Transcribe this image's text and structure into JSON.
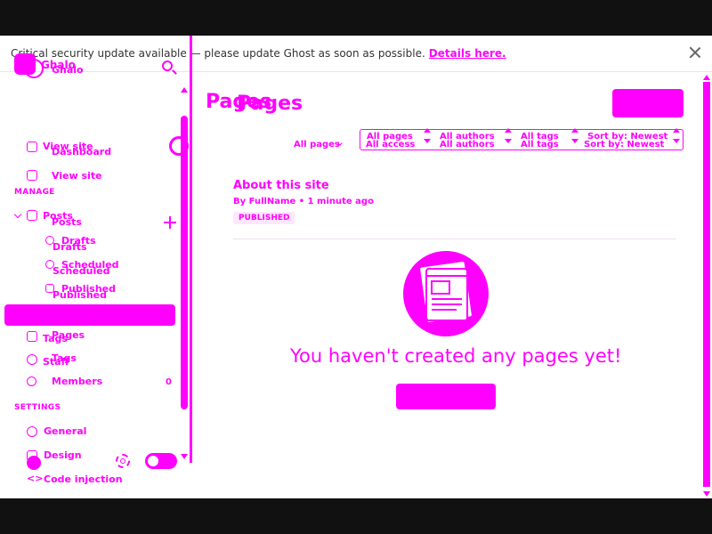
{
  "banner": {
    "text": "Critical security update available — please update Ghost as soon as possible.",
    "link": "Details here."
  },
  "sidebar": {
    "site_title": "Ghalo",
    "site_title_overlay": "Ghalo",
    "nav_top": [
      {
        "label": "View site",
        "overlay": "Dashboard"
      },
      {
        "label": "View site"
      }
    ],
    "manage_label": "MANAGE",
    "posts": {
      "label": "Posts",
      "overlay": "Posts"
    },
    "post_subitems": [
      {
        "label": "Drafts",
        "overlay": "Drafts"
      },
      {
        "label": "Scheduled",
        "overlay": "Scheduled"
      },
      {
        "label": "Published",
        "overlay": "Published"
      }
    ],
    "pages": {
      "label": "Pages"
    },
    "tags": {
      "label": "Tags",
      "overlay": "Tags"
    },
    "staff": {
      "label": "Staff"
    },
    "members": {
      "label": "Members",
      "count": "0"
    },
    "settings_label": "SETTINGS",
    "settings_items": [
      {
        "label": "General"
      },
      {
        "label": "Design"
      },
      {
        "label": "Code injection"
      }
    ]
  },
  "main": {
    "title": "Pages",
    "title_overlay": "Pages",
    "filters": {
      "all_pages_left": "All pages",
      "all_pages": "All pages",
      "all_access": "All access",
      "all_authors": "All authors",
      "all_authors_2": "All authors",
      "all_tags": "All tags",
      "all_tags_2": "All tags",
      "sort_newest": "Sort by: Newest",
      "sort_newest_2": "Sort by: Newest"
    },
    "post": {
      "title": "About this site",
      "meta": "By FullName • 1 minute ago",
      "status": "PUBLISHED"
    },
    "empty_heading": "You haven't created any pages yet!"
  },
  "colors": {
    "accent": "#ff00ff"
  }
}
